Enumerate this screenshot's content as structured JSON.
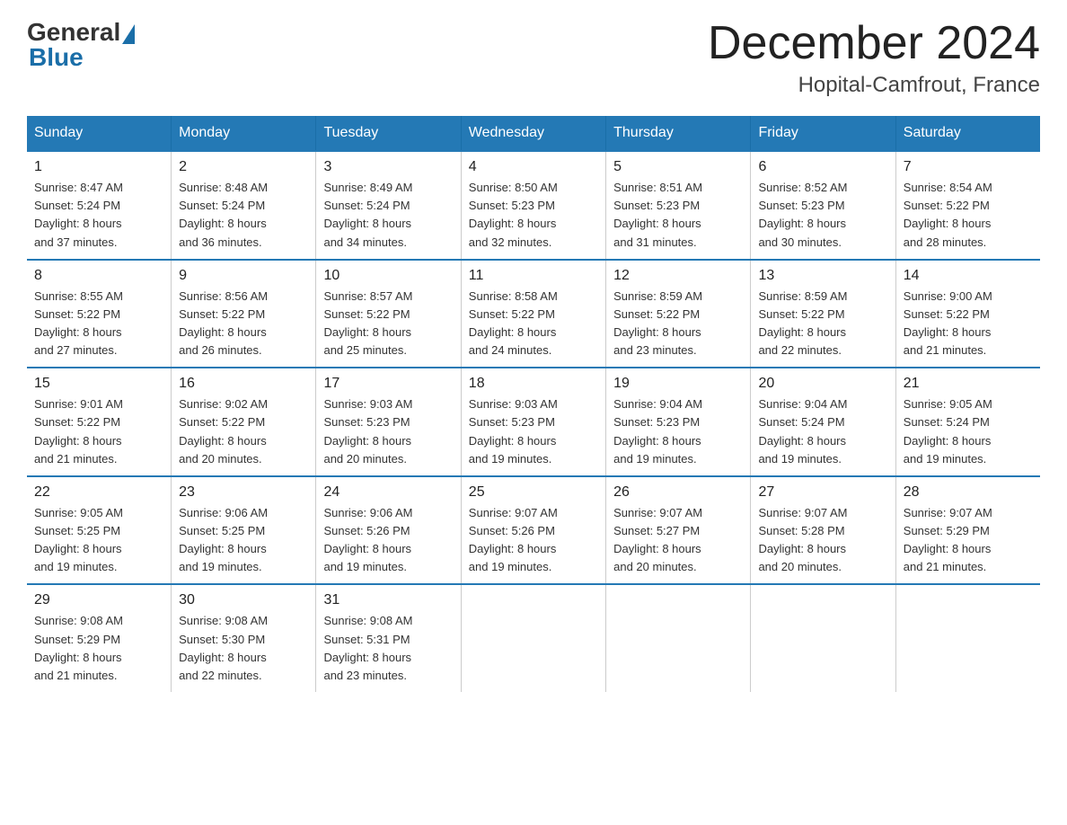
{
  "logo": {
    "general": "General",
    "blue": "Blue"
  },
  "title": {
    "month": "December 2024",
    "location": "Hopital-Camfrout, France"
  },
  "days_header": [
    "Sunday",
    "Monday",
    "Tuesday",
    "Wednesday",
    "Thursday",
    "Friday",
    "Saturday"
  ],
  "weeks": [
    [
      {
        "num": "1",
        "sunrise": "8:47 AM",
        "sunset": "5:24 PM",
        "daylight": "8 hours and 37 minutes."
      },
      {
        "num": "2",
        "sunrise": "8:48 AM",
        "sunset": "5:24 PM",
        "daylight": "8 hours and 36 minutes."
      },
      {
        "num": "3",
        "sunrise": "8:49 AM",
        "sunset": "5:24 PM",
        "daylight": "8 hours and 34 minutes."
      },
      {
        "num": "4",
        "sunrise": "8:50 AM",
        "sunset": "5:23 PM",
        "daylight": "8 hours and 32 minutes."
      },
      {
        "num": "5",
        "sunrise": "8:51 AM",
        "sunset": "5:23 PM",
        "daylight": "8 hours and 31 minutes."
      },
      {
        "num": "6",
        "sunrise": "8:52 AM",
        "sunset": "5:23 PM",
        "daylight": "8 hours and 30 minutes."
      },
      {
        "num": "7",
        "sunrise": "8:54 AM",
        "sunset": "5:22 PM",
        "daylight": "8 hours and 28 minutes."
      }
    ],
    [
      {
        "num": "8",
        "sunrise": "8:55 AM",
        "sunset": "5:22 PM",
        "daylight": "8 hours and 27 minutes."
      },
      {
        "num": "9",
        "sunrise": "8:56 AM",
        "sunset": "5:22 PM",
        "daylight": "8 hours and 26 minutes."
      },
      {
        "num": "10",
        "sunrise": "8:57 AM",
        "sunset": "5:22 PM",
        "daylight": "8 hours and 25 minutes."
      },
      {
        "num": "11",
        "sunrise": "8:58 AM",
        "sunset": "5:22 PM",
        "daylight": "8 hours and 24 minutes."
      },
      {
        "num": "12",
        "sunrise": "8:59 AM",
        "sunset": "5:22 PM",
        "daylight": "8 hours and 23 minutes."
      },
      {
        "num": "13",
        "sunrise": "8:59 AM",
        "sunset": "5:22 PM",
        "daylight": "8 hours and 22 minutes."
      },
      {
        "num": "14",
        "sunrise": "9:00 AM",
        "sunset": "5:22 PM",
        "daylight": "8 hours and 21 minutes."
      }
    ],
    [
      {
        "num": "15",
        "sunrise": "9:01 AM",
        "sunset": "5:22 PM",
        "daylight": "8 hours and 21 minutes."
      },
      {
        "num": "16",
        "sunrise": "9:02 AM",
        "sunset": "5:22 PM",
        "daylight": "8 hours and 20 minutes."
      },
      {
        "num": "17",
        "sunrise": "9:03 AM",
        "sunset": "5:23 PM",
        "daylight": "8 hours and 20 minutes."
      },
      {
        "num": "18",
        "sunrise": "9:03 AM",
        "sunset": "5:23 PM",
        "daylight": "8 hours and 19 minutes."
      },
      {
        "num": "19",
        "sunrise": "9:04 AM",
        "sunset": "5:23 PM",
        "daylight": "8 hours and 19 minutes."
      },
      {
        "num": "20",
        "sunrise": "9:04 AM",
        "sunset": "5:24 PM",
        "daylight": "8 hours and 19 minutes."
      },
      {
        "num": "21",
        "sunrise": "9:05 AM",
        "sunset": "5:24 PM",
        "daylight": "8 hours and 19 minutes."
      }
    ],
    [
      {
        "num": "22",
        "sunrise": "9:05 AM",
        "sunset": "5:25 PM",
        "daylight": "8 hours and 19 minutes."
      },
      {
        "num": "23",
        "sunrise": "9:06 AM",
        "sunset": "5:25 PM",
        "daylight": "8 hours and 19 minutes."
      },
      {
        "num": "24",
        "sunrise": "9:06 AM",
        "sunset": "5:26 PM",
        "daylight": "8 hours and 19 minutes."
      },
      {
        "num": "25",
        "sunrise": "9:07 AM",
        "sunset": "5:26 PM",
        "daylight": "8 hours and 19 minutes."
      },
      {
        "num": "26",
        "sunrise": "9:07 AM",
        "sunset": "5:27 PM",
        "daylight": "8 hours and 20 minutes."
      },
      {
        "num": "27",
        "sunrise": "9:07 AM",
        "sunset": "5:28 PM",
        "daylight": "8 hours and 20 minutes."
      },
      {
        "num": "28",
        "sunrise": "9:07 AM",
        "sunset": "5:29 PM",
        "daylight": "8 hours and 21 minutes."
      }
    ],
    [
      {
        "num": "29",
        "sunrise": "9:08 AM",
        "sunset": "5:29 PM",
        "daylight": "8 hours and 21 minutes."
      },
      {
        "num": "30",
        "sunrise": "9:08 AM",
        "sunset": "5:30 PM",
        "daylight": "8 hours and 22 minutes."
      },
      {
        "num": "31",
        "sunrise": "9:08 AM",
        "sunset": "5:31 PM",
        "daylight": "8 hours and 23 minutes."
      },
      null,
      null,
      null,
      null
    ]
  ],
  "labels": {
    "sunrise": "Sunrise:",
    "sunset": "Sunset:",
    "daylight": "Daylight:"
  }
}
